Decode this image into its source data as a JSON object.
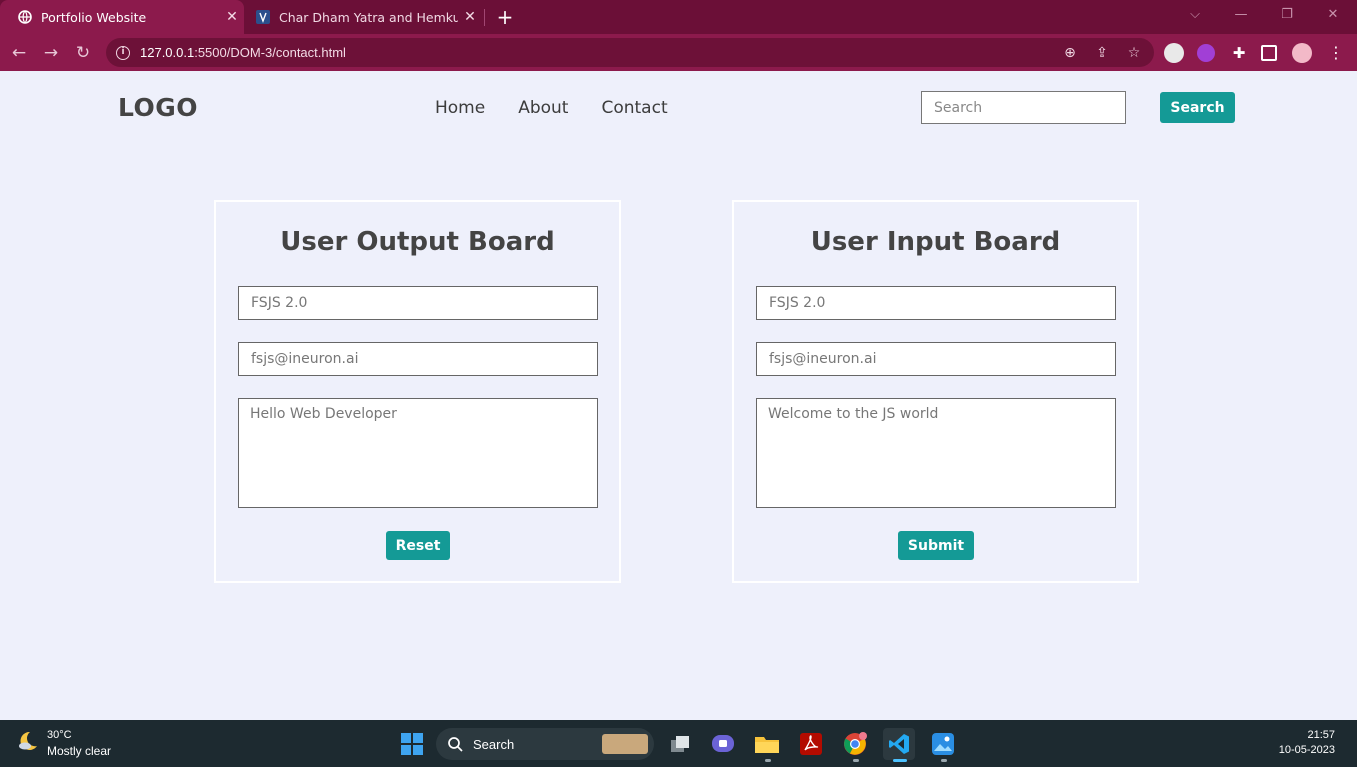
{
  "browser": {
    "tabs": [
      {
        "title": "Portfolio Website",
        "active": true
      },
      {
        "title": "Char Dham Yatra and Hemkund S",
        "active": false
      }
    ],
    "url_host": "127.0.0.1",
    "url_rest": ":5500/DOM-3/contact.html"
  },
  "header": {
    "logo": "LOGO",
    "nav": [
      "Home",
      "About",
      "Contact"
    ],
    "search_placeholder": "Search",
    "search_button": "Search"
  },
  "output_board": {
    "title": "User Output Board",
    "name_placeholder": "FSJS 2.0",
    "email_placeholder": "fsjs@ineuron.ai",
    "message_placeholder": "Hello Web Developer",
    "button": "Reset"
  },
  "input_board": {
    "title": "User Input Board",
    "name_placeholder": "FSJS 2.0",
    "email_placeholder": "fsjs@ineuron.ai",
    "message_placeholder": "Welcome to the JS world",
    "button": "Submit"
  },
  "taskbar": {
    "weather_temp": "30°C",
    "weather_desc": "Mostly clear",
    "search_label": "Search",
    "time": "21:57",
    "date": "10-05-2023"
  },
  "colors": {
    "accent": "#149a96",
    "chrome_toolbar": "#8c1a4c",
    "chrome_tabbar": "#6b0f37",
    "page_bg": "#eef0fb"
  }
}
